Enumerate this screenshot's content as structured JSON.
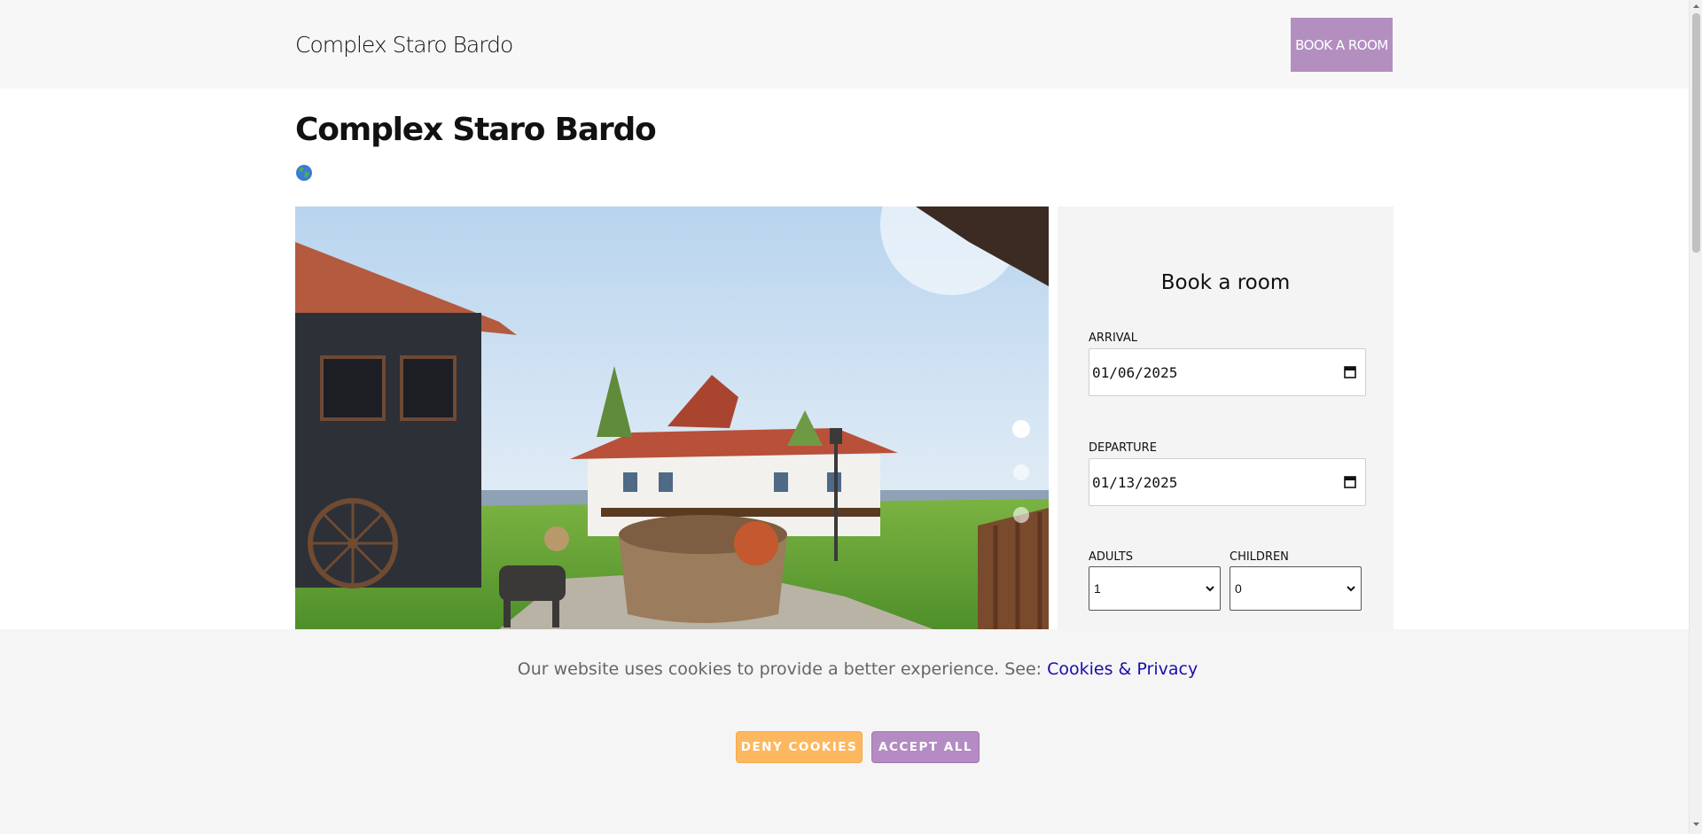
{
  "header": {
    "brand": "Complex Staro Bardo",
    "book_button": "BOOK A ROOM"
  },
  "main": {
    "title": "Complex Staro Bardo",
    "language_icon": "globe-icon"
  },
  "slider": {
    "image": "courtyard-photo",
    "slide_count": 3,
    "active_slide": 1
  },
  "booking": {
    "title": "Book a room",
    "arrival_label": "ARRIVAL",
    "arrival_value": "01/06/2025",
    "departure_label": "DEPARTURE",
    "departure_value": "01/13/2025",
    "adults_label": "ADULTS",
    "adults_value": "1",
    "children_label": "CHILDREN",
    "children_value": "0"
  },
  "cookie_banner": {
    "text": "Our website uses cookies to provide a better experience. See:",
    "link": "Cookies & Privacy",
    "deny": "DENY COOKIES",
    "accept": "ACCEPT ALL"
  },
  "colors": {
    "accent": "#b38fc0",
    "deny": "#fdb85f",
    "link": "#1a0dab"
  }
}
